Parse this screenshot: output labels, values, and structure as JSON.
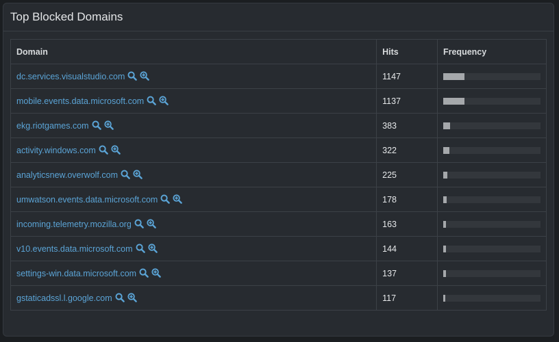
{
  "panel": {
    "title": "Top Blocked Domains"
  },
  "table": {
    "headers": {
      "domain": "Domain",
      "hits": "Hits",
      "frequency": "Frequency"
    },
    "rows": [
      {
        "domain": "dc.services.visualstudio.com",
        "hits": "1147",
        "frequency_pct": 21.8
      },
      {
        "domain": "mobile.events.data.microsoft.com",
        "hits": "1137",
        "frequency_pct": 21.6
      },
      {
        "domain": "ekg.riotgames.com",
        "hits": "383",
        "frequency_pct": 7.3
      },
      {
        "domain": "activity.windows.com",
        "hits": "322",
        "frequency_pct": 6.1
      },
      {
        "domain": "analyticsnew.overwolf.com",
        "hits": "225",
        "frequency_pct": 4.3
      },
      {
        "domain": "umwatson.events.data.microsoft.com",
        "hits": "178",
        "frequency_pct": 3.4
      },
      {
        "domain": "incoming.telemetry.mozilla.org",
        "hits": "163",
        "frequency_pct": 3.1
      },
      {
        "domain": "v10.events.data.microsoft.com",
        "hits": "144",
        "frequency_pct": 2.7
      },
      {
        "domain": "settings-win.data.microsoft.com",
        "hits": "137",
        "frequency_pct": 2.6
      },
      {
        "domain": "gstaticadssl.l.google.com",
        "hits": "117",
        "frequency_pct": 2.2
      }
    ]
  },
  "icons": {
    "search": "search-icon",
    "zoom_in": "zoom-in-icon"
  },
  "colors": {
    "link": "#5ba4d6",
    "bar_fill": "#a5a8ab",
    "bar_track": "#33373c"
  }
}
